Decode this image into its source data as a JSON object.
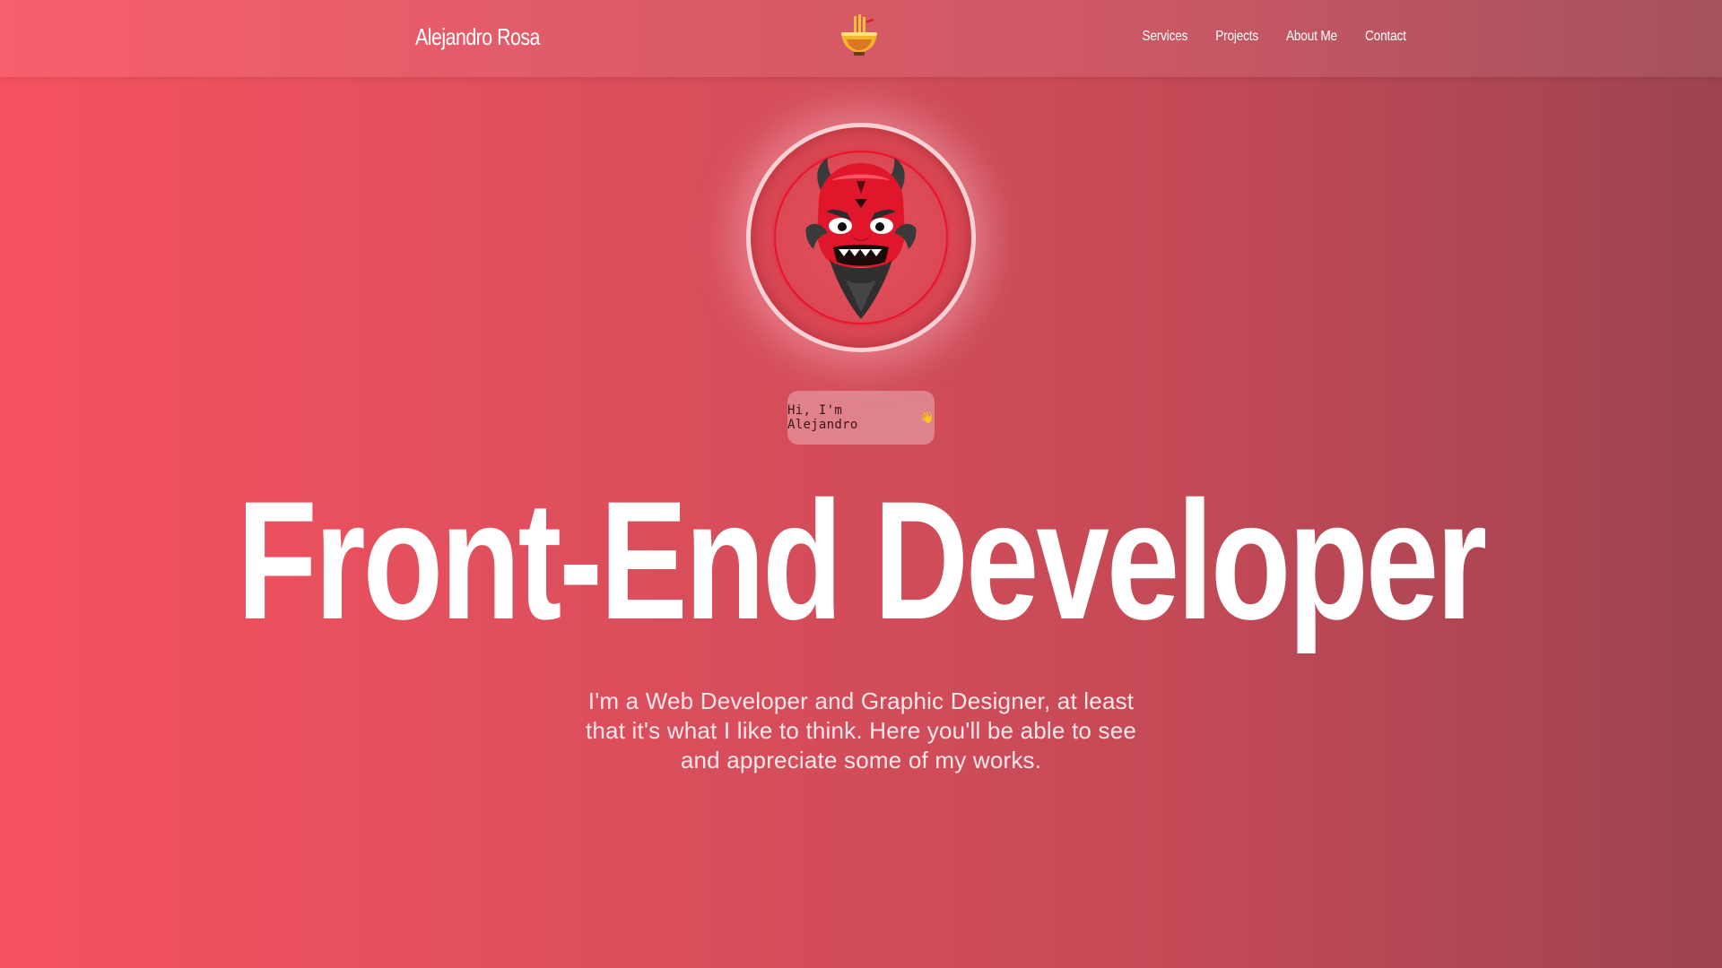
{
  "navbar": {
    "brand": "Alejandro Rosa",
    "logo_icon": "noodle-bowl-icon",
    "links": [
      {
        "label": "Services"
      },
      {
        "label": "Projects"
      },
      {
        "label": "About Me"
      },
      {
        "label": "Contact"
      }
    ]
  },
  "hero": {
    "avatar_icon": "oni-mask-avatar",
    "greeting": "Hi, I'm Alejandro",
    "greeting_emoji": "👋",
    "headline": "Front-End Developer",
    "intro": "I'm a Web Developer and Graphic Designer, at least that it's what I like to think. Here you'll be able to see and appreciate some of my works."
  },
  "colors": {
    "gradient_left": "#f6525f",
    "gradient_right": "#9e4450",
    "accent_red": "#e8142c"
  }
}
